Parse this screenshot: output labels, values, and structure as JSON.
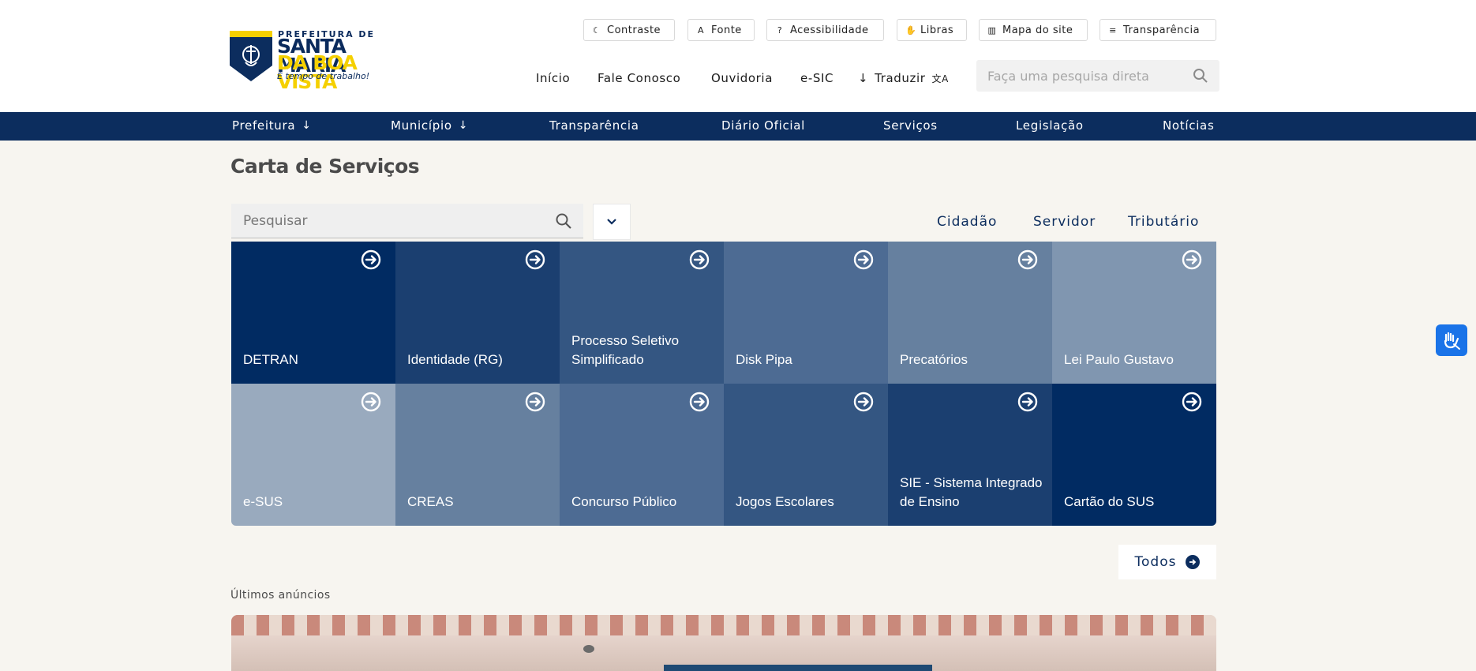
{
  "logo": {
    "line1": "PREFEITURA DE",
    "line2": "SANTA MARIA",
    "line3": "DA BOA VISTA",
    "tagline": "É tempo de trabalho!"
  },
  "utility": {
    "contrast": "Contraste",
    "font": "Fonte",
    "accessibility": "Acessibilidade",
    "libras": "Libras",
    "sitemap": "Mapa do site",
    "transparency": "Transparência"
  },
  "topnav": {
    "home": "Início",
    "contact": "Fale Conosco",
    "ombudsman": "Ouvidoria",
    "esic": "e-SIC",
    "translate": "Traduzir"
  },
  "top_search": {
    "placeholder": "Faça uma pesquisa direta"
  },
  "mainnav": {
    "prefeitura": "Prefeitura",
    "municipio": "Município",
    "transparencia": "Transparência",
    "diario": "Diário Oficial",
    "servicos": "Serviços",
    "legislacao": "Legislação",
    "noticias": "Notícias"
  },
  "services": {
    "title": "Carta de Serviços",
    "search_placeholder": "Pesquisar",
    "tabs": {
      "cidadao": "Cidadão",
      "servidor": "Servidor",
      "tributario": "Tributário"
    },
    "cards": [
      {
        "label": "DETRAN",
        "color": "#012b62"
      },
      {
        "label": "Identidade (RG)",
        "color": "#1b3f70"
      },
      {
        "label": "Processo Seletivo Simplificado",
        "color": "#345682"
      },
      {
        "label": "Disk Pipa",
        "color": "#4d6b93"
      },
      {
        "label": "Precatórios",
        "color": "#66809f"
      },
      {
        "label": "Lei Paulo Gustavo",
        "color": "#8096b0"
      },
      {
        "label": "e-SUS",
        "color": "#99aabe"
      },
      {
        "label": "CREAS",
        "color": "#66809f"
      },
      {
        "label": "Concurso Público",
        "color": "#4d6b93"
      },
      {
        "label": "Jogos Escolares",
        "color": "#345682"
      },
      {
        "label": "SIE - Sistema Integrado de Ensino",
        "color": "#1b3f70"
      },
      {
        "label": "Cartão do SUS",
        "color": "#012b62"
      }
    ],
    "all_button": "Todos"
  },
  "announcements": {
    "label": "Últimos anúncios"
  }
}
